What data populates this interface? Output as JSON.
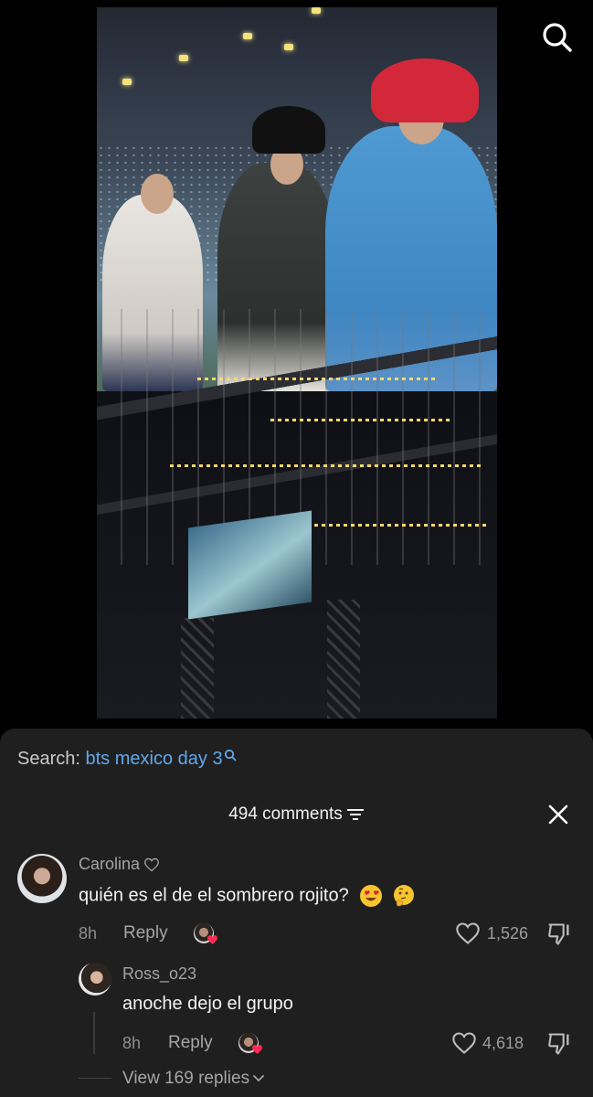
{
  "search": {
    "prefix": "Search:",
    "query": "bts mexico day 3"
  },
  "comments_header": {
    "count_label": "494 comments"
  },
  "comments": [
    {
      "username": "Carolina",
      "text": "quién es el de el sombrero rojito?",
      "emojis": [
        "heart-eyes-emoji",
        "thinking-face-emoji"
      ],
      "time": "8h",
      "reply_label": "Reply",
      "likes": "1,526"
    }
  ],
  "replies": [
    {
      "username": "Ross_o23",
      "text": "anoche dejo el grupo",
      "time": "8h",
      "reply_label": "Reply",
      "likes": "4,618"
    }
  ],
  "view_replies_label": "View 169 replies",
  "colors": {
    "panel_bg": "#1f1f1f",
    "accent_link": "#62a8ec",
    "liked_heart": "#fe2c55"
  }
}
